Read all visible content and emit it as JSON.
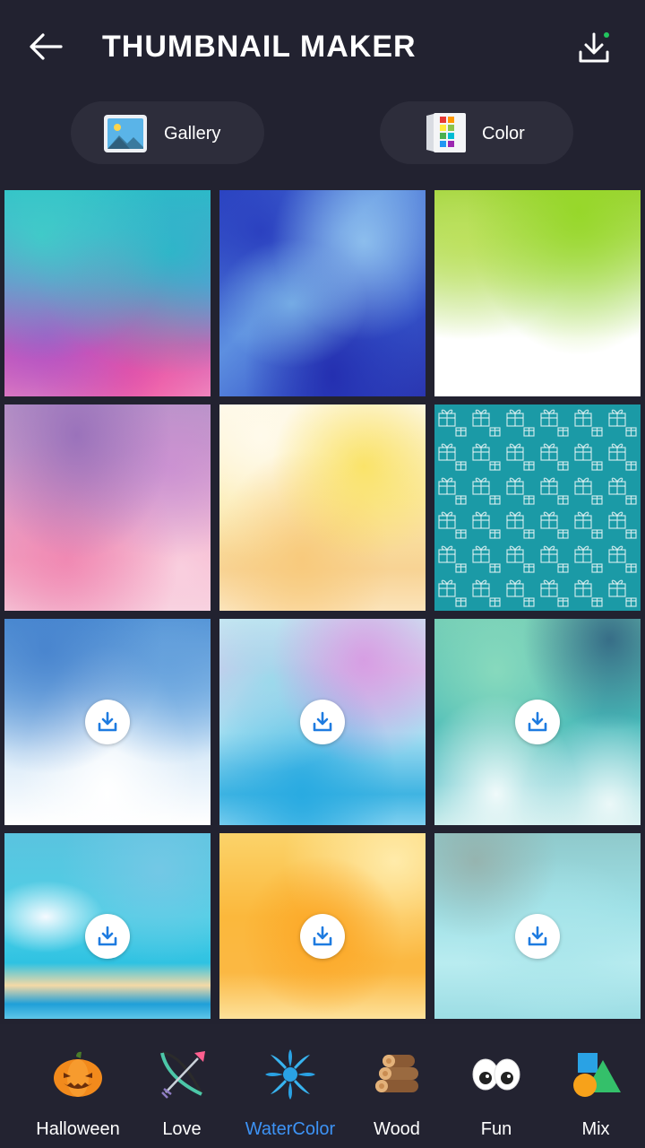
{
  "header": {
    "title": "THUMBNAIL MAKER",
    "back_icon": "arrow-left-icon",
    "download_icon": "download-tray-icon"
  },
  "sources": {
    "gallery": {
      "label": "Gallery",
      "icon": "gallery-image-icon"
    },
    "color": {
      "label": "Color",
      "icon": "color-palette-book-icon"
    }
  },
  "grid": {
    "tiles": [
      {
        "name": "watercolor-teal-pink",
        "downloadable": false
      },
      {
        "name": "watercolor-blue",
        "downloadable": false
      },
      {
        "name": "watercolor-green-white",
        "downloadable": false
      },
      {
        "name": "watercolor-purple-pink",
        "downloadable": false
      },
      {
        "name": "watercolor-yellow-cream",
        "downloadable": false
      },
      {
        "name": "teal-gift-pattern",
        "downloadable": false
      },
      {
        "name": "watercolor-sky-blue",
        "downloadable": true
      },
      {
        "name": "watercolor-cyan-violet",
        "downloadable": true
      },
      {
        "name": "watercolor-green-clouds",
        "downloadable": true
      },
      {
        "name": "watercolor-cyan-clouds",
        "downloadable": true
      },
      {
        "name": "watercolor-orange-yellow",
        "downloadable": true
      },
      {
        "name": "watercolor-pale-turquoise",
        "downloadable": true
      }
    ]
  },
  "categories": [
    {
      "label": "Halloween",
      "icon": "pumpkin-icon"
    },
    {
      "label": "Love",
      "icon": "cupid-bow-icon"
    },
    {
      "label": "WaterColor",
      "icon": "water-splash-icon",
      "active": true
    },
    {
      "label": "Wood",
      "icon": "wood-logs-icon"
    },
    {
      "label": "Fun",
      "icon": "googly-eyes-icon"
    },
    {
      "label": "Mix",
      "icon": "shapes-icon"
    }
  ],
  "colors": {
    "background": "#222230",
    "pill": "#2d2d3b",
    "accent": "#3d93f5",
    "download_dot": "#22c55e"
  }
}
